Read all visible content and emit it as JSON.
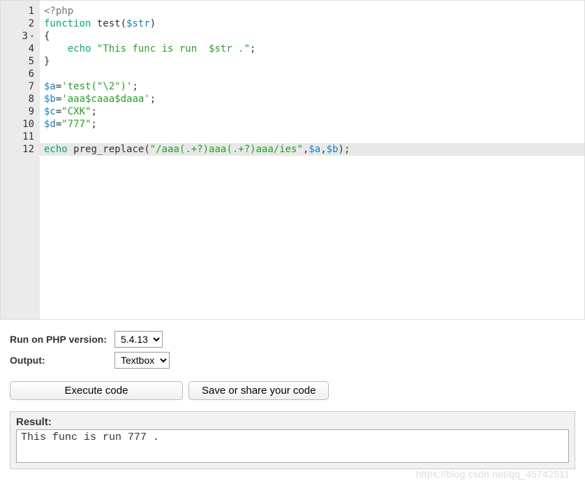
{
  "editor": {
    "highlight_line": 12,
    "fold_line": 3,
    "lines": [
      {
        "n": 1,
        "tokens": [
          {
            "t": "<?php",
            "c": "tok-phptag"
          }
        ]
      },
      {
        "n": 2,
        "tokens": [
          {
            "t": "function",
            "c": "tok-kw"
          },
          {
            "t": " "
          },
          {
            "t": "test",
            "c": "tok-funcname"
          },
          {
            "t": "(",
            "c": "tok-paren"
          },
          {
            "t": "$str",
            "c": "tok-var"
          },
          {
            "t": ")",
            "c": "tok-paren"
          }
        ]
      },
      {
        "n": 3,
        "tokens": [
          {
            "t": "{",
            "c": "tok-brace"
          }
        ]
      },
      {
        "n": 4,
        "tokens": [
          {
            "t": "    "
          },
          {
            "t": "echo",
            "c": "tok-kw"
          },
          {
            "t": " "
          },
          {
            "t": "\"This func is run  $str .\"",
            "c": "tok-str"
          },
          {
            "t": ";",
            "c": "tok-semi"
          }
        ]
      },
      {
        "n": 5,
        "tokens": [
          {
            "t": "}",
            "c": "tok-brace"
          }
        ]
      },
      {
        "n": 6,
        "tokens": []
      },
      {
        "n": 7,
        "tokens": [
          {
            "t": "$a",
            "c": "tok-var"
          },
          {
            "t": "=",
            "c": "tok-op"
          },
          {
            "t": "'test(\"\\2\")'",
            "c": "tok-str"
          },
          {
            "t": ";",
            "c": "tok-semi"
          }
        ]
      },
      {
        "n": 8,
        "tokens": [
          {
            "t": "$b",
            "c": "tok-var"
          },
          {
            "t": "=",
            "c": "tok-op"
          },
          {
            "t": "'aaa$caaa$daaa'",
            "c": "tok-str"
          },
          {
            "t": ";",
            "c": "tok-semi"
          }
        ]
      },
      {
        "n": 9,
        "tokens": [
          {
            "t": "$c",
            "c": "tok-var"
          },
          {
            "t": "=",
            "c": "tok-op"
          },
          {
            "t": "\"CXK\"",
            "c": "tok-str"
          },
          {
            "t": ";",
            "c": "tok-semi"
          }
        ]
      },
      {
        "n": 10,
        "tokens": [
          {
            "t": "$d",
            "c": "tok-var"
          },
          {
            "t": "=",
            "c": "tok-op"
          },
          {
            "t": "\"777\"",
            "c": "tok-str"
          },
          {
            "t": ";",
            "c": "tok-semi"
          }
        ]
      },
      {
        "n": 11,
        "tokens": []
      },
      {
        "n": 12,
        "tokens": [
          {
            "t": "echo",
            "c": "tok-kw"
          },
          {
            "t": " "
          },
          {
            "t": "preg_replace",
            "c": "tok-func"
          },
          {
            "t": "(",
            "c": "tok-paren"
          },
          {
            "t": "\"/aaa(.+?)aaa(.+?)aaa/ies\"",
            "c": "tok-str"
          },
          {
            "t": ",",
            "c": "tok-op"
          },
          {
            "t": "$a",
            "c": "tok-var"
          },
          {
            "t": ",",
            "c": "tok-op"
          },
          {
            "t": "$b",
            "c": "tok-var"
          },
          {
            "t": ")",
            "c": "tok-paren"
          },
          {
            "t": ";",
            "c": "tok-semi"
          }
        ]
      }
    ]
  },
  "controls": {
    "version_label": "Run on PHP version:",
    "version_value": "5.4.13",
    "output_label": "Output:",
    "output_value": "Textbox"
  },
  "buttons": {
    "execute": "Execute code",
    "save": "Save or share your code"
  },
  "result": {
    "label": "Result:",
    "text": "This func is run  777 ."
  },
  "watermark": "https://blog.csdn.net/qq_45742511"
}
